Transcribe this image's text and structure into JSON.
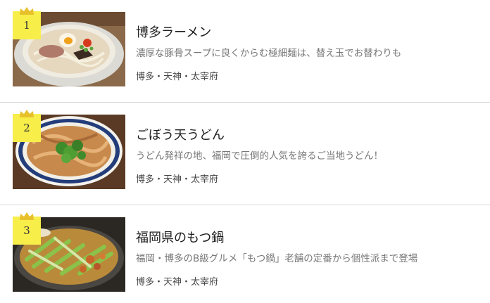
{
  "items": [
    {
      "rank": "1",
      "title": "博多ラーメン",
      "description": "濃厚な豚骨スープに良くからむ極細麺は、替え玉でお替わりも",
      "area": "博多・天神・太宰府",
      "image": "ramen-photo"
    },
    {
      "rank": "2",
      "title": "ごぼう天うどん",
      "description": "うどん発祥の地、福岡で圧倒的人気を誇るご当地うどん！",
      "area": "博多・天神・太宰府",
      "image": "gobouten-udon-photo"
    },
    {
      "rank": "3",
      "title": "福岡県のもつ鍋",
      "description": "福岡・博多のB級グルメ「もつ鍋」老舗の定番から個性派まで登場",
      "area": "博多・天神・太宰府",
      "image": "motsunabe-photo"
    }
  ],
  "colors": {
    "rank_badge": "#f7ee4a",
    "crown": "#e8c12a",
    "divider": "#d6d6d6"
  }
}
